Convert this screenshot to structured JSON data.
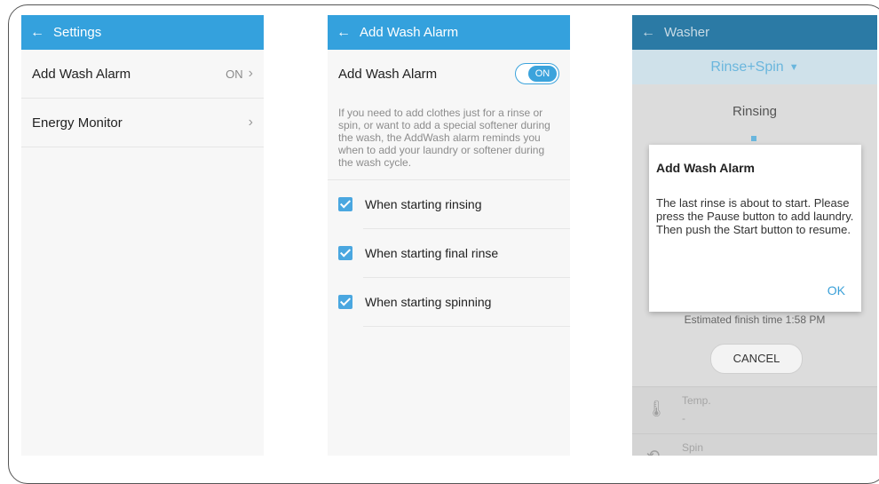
{
  "phone1": {
    "appbar_title": "Settings",
    "rows": [
      {
        "label": "Add Wash Alarm",
        "value": "ON"
      },
      {
        "label": "Energy Monitor",
        "value": ""
      }
    ]
  },
  "phone2": {
    "appbar_title": "Add Wash Alarm",
    "toggle_label": "Add Wash Alarm",
    "toggle_state": "ON",
    "description": "If you need to add clothes just for a rinse or spin, or want to add a special softener during the wash, the AddWash alarm reminds you when to add your laundry or softener during the wash cycle.",
    "options": [
      {
        "label": "When starting rinsing",
        "checked": true
      },
      {
        "label": "When starting final rinse",
        "checked": true
      },
      {
        "label": "When starting spinning",
        "checked": true
      }
    ]
  },
  "phone3": {
    "appbar_title": "Washer",
    "mode": "Rinse+Spin",
    "status": "Rinsing",
    "finish_text": "Estimated finish time 1:58 PM",
    "cancel_label": "CANCEL",
    "sections": [
      {
        "label": "Temp.",
        "value": "-"
      },
      {
        "label": "Spin",
        "value": ""
      }
    ],
    "dialog": {
      "title": "Add Wash Alarm",
      "body": "The last rinse is about to start. Please press the Pause button to add laundry. Then push the Start button to resume.",
      "ok_label": "OK"
    }
  },
  "colors": {
    "accent": "#34a1dd",
    "appbar_dimmed": "#2b7aa5"
  }
}
